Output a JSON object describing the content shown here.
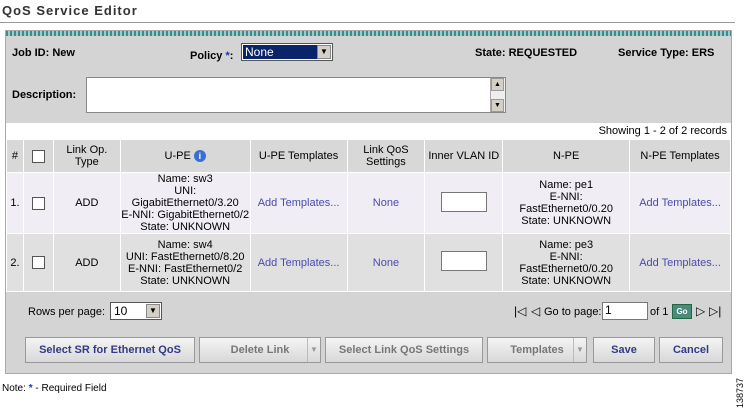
{
  "title": "QoS Service Editor",
  "header": {
    "job_id": "Job ID: New",
    "policy_label": "Policy",
    "policy_required": "*",
    "policy_colon": ":",
    "policy_value": "None",
    "state": "State: REQUESTED",
    "service_type": "Service Type: ERS",
    "description_label": "Description:",
    "description_value": ""
  },
  "table": {
    "showing": "Showing 1 - 2 of 2 records",
    "columns": [
      "#",
      "",
      "Link Op. Type",
      "U-PE",
      "U-PE Templates",
      "Link QoS Settings",
      "Inner VLAN ID",
      "N-PE",
      "N-PE Templates"
    ],
    "rows": [
      {
        "num": "1.",
        "op": "ADD",
        "upe": [
          "Name: sw3",
          "UNI: GigabitEthernet0/3.20",
          "E-NNI: GigabitEthernet0/2",
          "State: UNKNOWN"
        ],
        "upe_templates": "Add Templates...",
        "qos": "None",
        "vlan": "",
        "npe": [
          "Name: pe1",
          "E-NNI: FastEthernet0/0.20",
          "State: UNKNOWN"
        ],
        "npe_templates": "Add Templates..."
      },
      {
        "num": "2.",
        "op": "ADD",
        "upe": [
          "Name: sw4",
          "UNI: FastEthernet0/8.20",
          "E-NNI: FastEthernet0/2",
          "State: UNKNOWN"
        ],
        "upe_templates": "Add Templates...",
        "qos": "None",
        "vlan": "",
        "npe": [
          "Name: pe3",
          "E-NNI: FastEthernet0/0.20",
          "State: UNKNOWN"
        ],
        "npe_templates": "Add Templates..."
      }
    ]
  },
  "pager": {
    "rows_per_page_label": "Rows per page:",
    "rows_per_page_value": "10",
    "goto_label": "Go to page:",
    "page_value": "1",
    "of_label": "of 1",
    "go": "Go"
  },
  "buttons": {
    "select_sr": "Select SR for Ethernet QoS",
    "delete_link": "Delete Link",
    "select_qos": "Select Link QoS Settings",
    "templates": "Templates",
    "save": "Save",
    "cancel": "Cancel"
  },
  "note": {
    "prefix": "Note:",
    "star": "*",
    "text": "- Required Field"
  },
  "figure_id": "138737",
  "colors": {
    "link": "#4a4ab0",
    "required": "#2030c0",
    "accent": "#3a8d8d"
  }
}
